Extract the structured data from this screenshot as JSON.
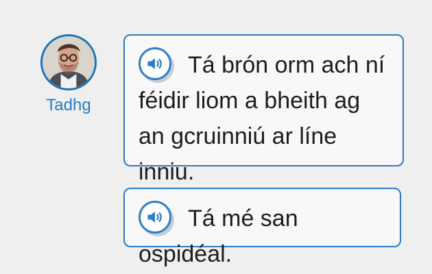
{
  "speaker": {
    "name": "Tadhg"
  },
  "messages": [
    {
      "text": "Tá brón orm ach ní féidir liom a bheith ag an gcruinniú ar líne inniu."
    },
    {
      "text": "Tá mé san ospidéal."
    }
  ],
  "icons": {
    "audio": "speaker-volume-icon"
  },
  "colors": {
    "accent": "#2b7bc2",
    "name": "#2a79c7",
    "bubble_bg": "#f8f8f8",
    "page_bg": "#efefef"
  }
}
